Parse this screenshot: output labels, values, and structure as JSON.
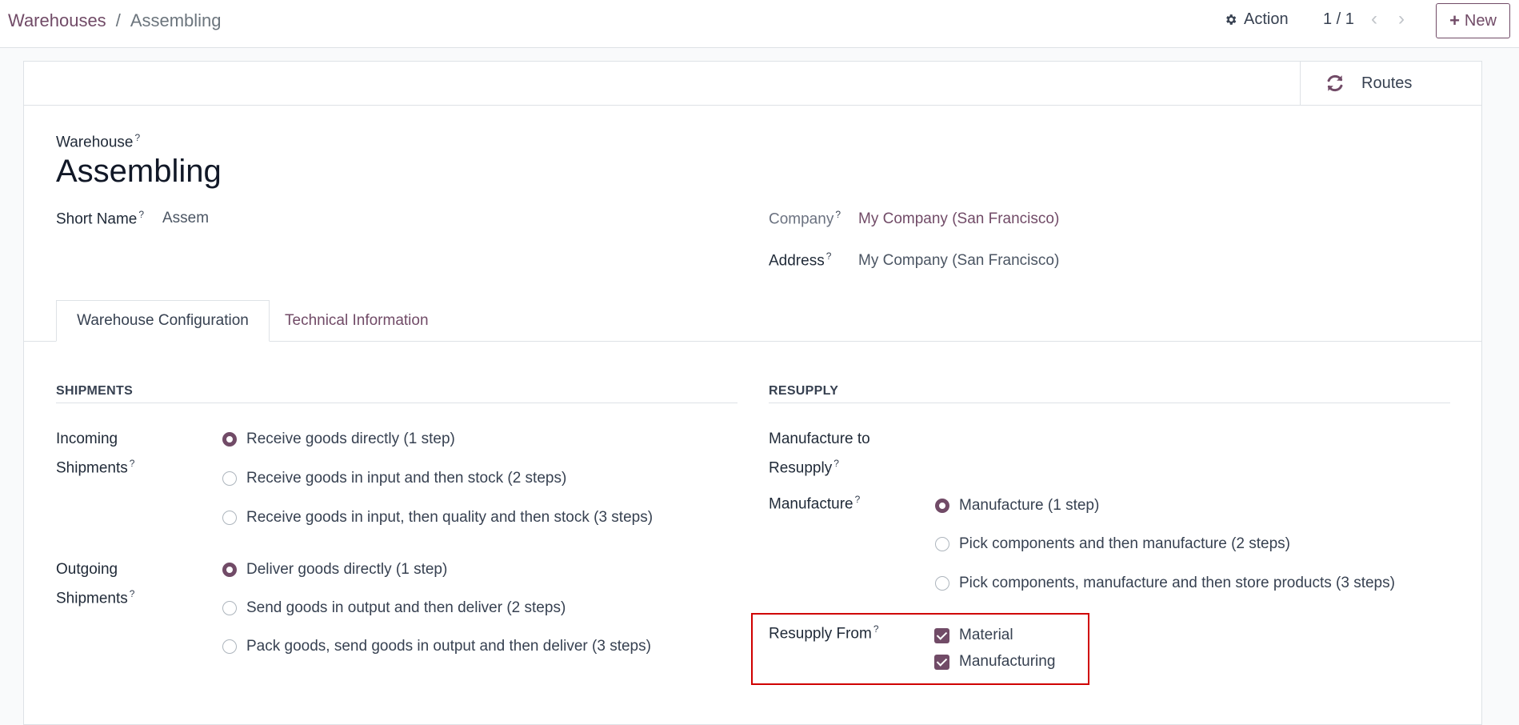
{
  "breadcrumb": {
    "parent": "Warehouses",
    "separator": "/",
    "current": "Assembling"
  },
  "controls": {
    "action_label": "Action",
    "pager": "1 / 1",
    "new_label": "New"
  },
  "button_box": {
    "routes_label": "Routes"
  },
  "form": {
    "warehouse_label": "Warehouse",
    "title": "Assembling",
    "short_name_label": "Short Name",
    "short_name_value": "Assem",
    "company_label": "Company",
    "company_value": "My Company (San Francisco)",
    "address_label": "Address",
    "address_value": "My Company (San Francisco)",
    "help_mark": "?"
  },
  "tabs": [
    "Warehouse Configuration",
    "Technical Information"
  ],
  "shipments": {
    "title": "SHIPMENTS",
    "incoming_label_1": "Incoming",
    "incoming_label_2": "Shipments",
    "incoming_options": [
      "Receive goods directly (1 step)",
      "Receive goods in input and then stock (2 steps)",
      "Receive goods in input, then quality and then stock (3 steps)"
    ],
    "incoming_selected": 0,
    "outgoing_label_1": "Outgoing",
    "outgoing_label_2": "Shipments",
    "outgoing_options": [
      "Deliver goods directly (1 step)",
      "Send goods in output and then deliver (2 steps)",
      "Pack goods, send goods in output and then deliver (3 steps)"
    ],
    "outgoing_selected": 0
  },
  "resupply": {
    "title": "RESUPPLY",
    "manufacture_to_resupply_label_1": "Manufacture to",
    "manufacture_to_resupply_label_2": "Resupply",
    "manufacture_to_resupply_checked": true,
    "manufacture_label": "Manufacture",
    "manufacture_options": [
      "Manufacture (1 step)",
      "Pick components and then manufacture (2 steps)",
      "Pick components, manufacture and then store products (3 steps)"
    ],
    "manufacture_selected": 0,
    "resupply_from_label": "Resupply From",
    "resupply_from_options": [
      "Material",
      "Manufacturing"
    ]
  },
  "colors": {
    "brand": "#714B67",
    "highlight": "#d00000"
  }
}
